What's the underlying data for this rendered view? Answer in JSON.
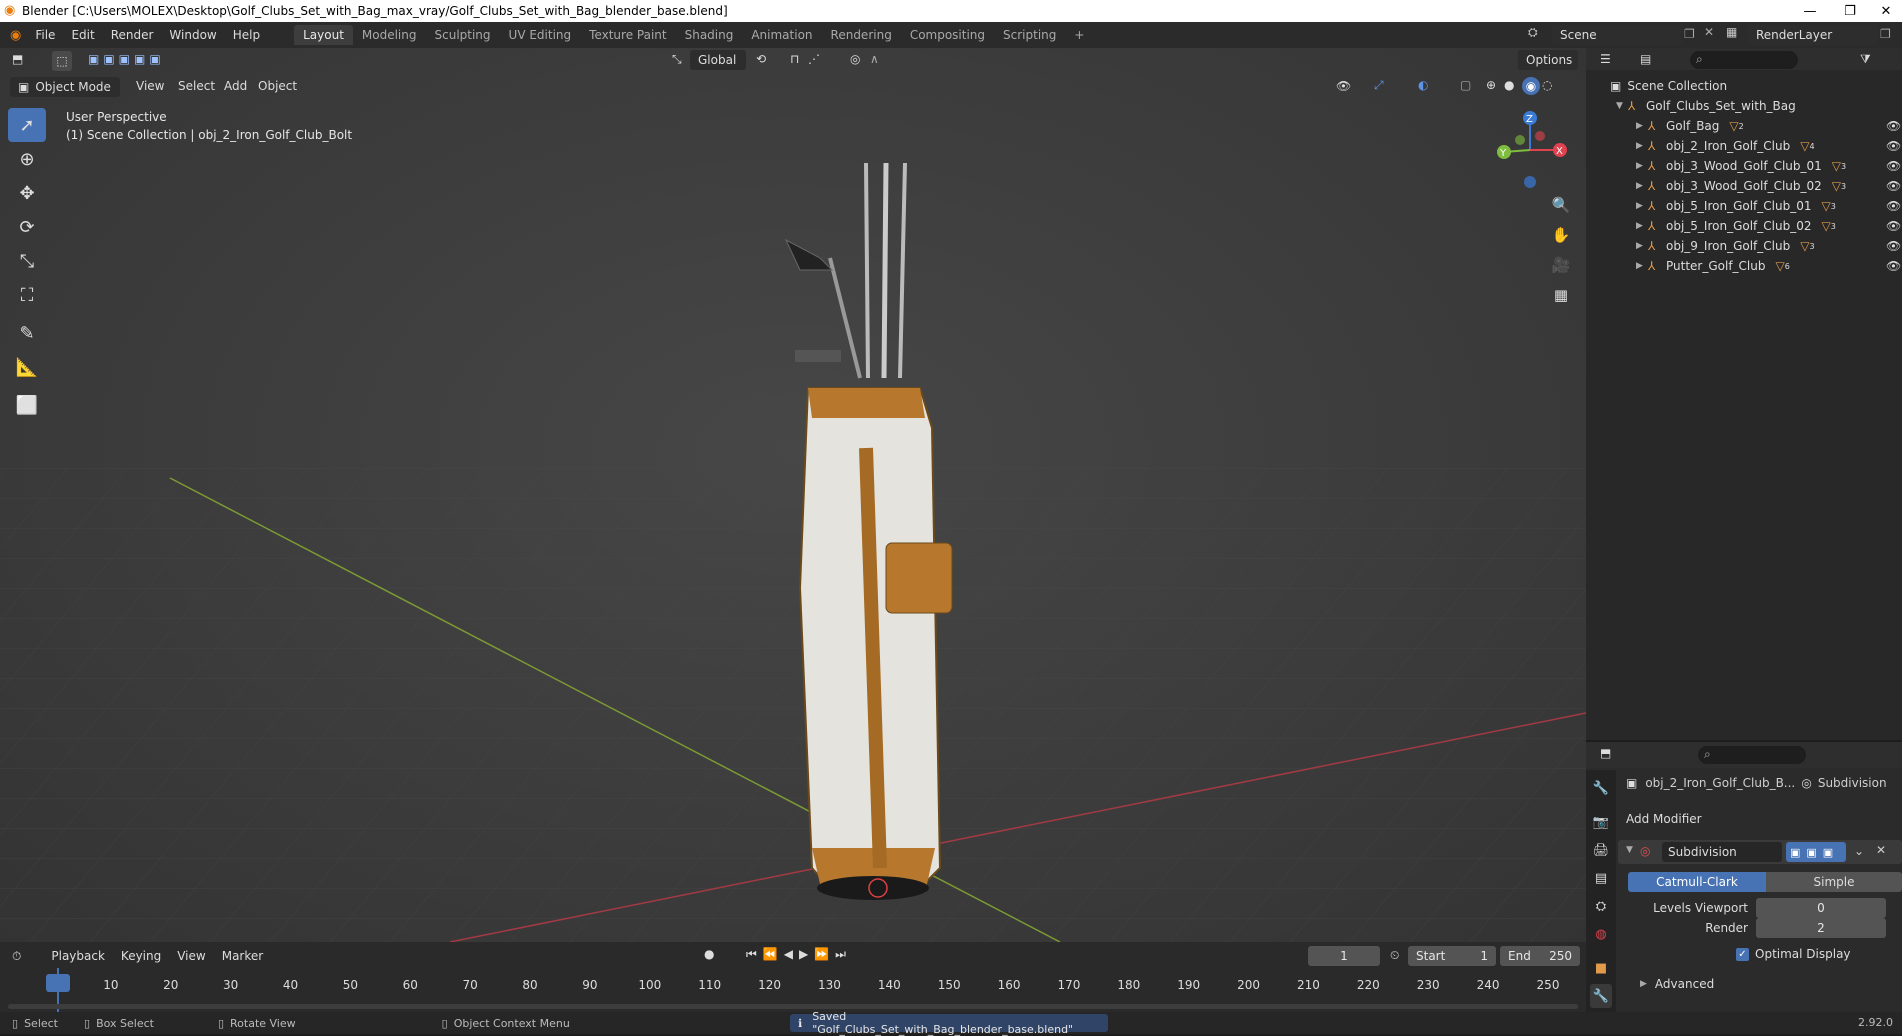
{
  "window": {
    "title": "Blender [C:\\Users\\MOLEX\\Desktop\\Golf_Clubs_Set_with_Bag_max_vray/Golf_Clubs_Set_with_Bag_blender_base.blend]",
    "minimize": "—",
    "maximize": "❐",
    "close": "✕"
  },
  "menubar": [
    "File",
    "Edit",
    "Render",
    "Window",
    "Help"
  ],
  "workspaces": [
    {
      "label": "Layout",
      "active": true
    },
    {
      "label": "Modeling"
    },
    {
      "label": "Sculpting"
    },
    {
      "label": "UV Editing"
    },
    {
      "label": "Texture Paint"
    },
    {
      "label": "Shading"
    },
    {
      "label": "Animation"
    },
    {
      "label": "Rendering"
    },
    {
      "label": "Compositing"
    },
    {
      "label": "Scripting"
    }
  ],
  "add_workspace": "+",
  "scene": {
    "label": "Scene",
    "render_layer": "RenderLayer"
  },
  "viewport_header": {
    "transform_orientation": "Global",
    "options": "Options",
    "mode": "Object Mode",
    "menus": [
      "View",
      "Select",
      "Add",
      "Object"
    ]
  },
  "viewport_overlay": {
    "perspective": "User Perspective",
    "collection_info": "(1) Scene Collection | obj_2_Iron_Golf_Club_Bolt"
  },
  "gizmo": {
    "x": "X",
    "y": "Y",
    "z": "Z"
  },
  "outliner": {
    "root": "Scene Collection",
    "collection": "Golf_Clubs_Set_with_Bag",
    "items": [
      {
        "name": "Golf_Bag",
        "count": "2"
      },
      {
        "name": "obj_2_Iron_Golf_Club",
        "count": "4"
      },
      {
        "name": "obj_3_Wood_Golf_Club_01",
        "count": "3"
      },
      {
        "name": "obj_3_Wood_Golf_Club_02",
        "count": "3"
      },
      {
        "name": "obj_5_Iron_Golf_Club_01",
        "count": "3"
      },
      {
        "name": "obj_5_Iron_Golf_Club_02",
        "count": "3"
      },
      {
        "name": "obj_9_Iron_Golf_Club",
        "count": "3"
      },
      {
        "name": "Putter_Golf_Club",
        "count": "6"
      }
    ]
  },
  "properties": {
    "object_name": "obj_2_Iron_Golf_Club_B...",
    "modifier_tab": "Subdivision",
    "add_modifier": "Add Modifier",
    "modifier": {
      "name": "Subdivision",
      "type_a": "Catmull-Clark",
      "type_b": "Simple",
      "levels_viewport_label": "Levels Viewport",
      "levels_viewport": "0",
      "render_label": "Render",
      "render": "2",
      "optimal_display": "Optimal Display",
      "advanced": "Advanced"
    }
  },
  "timeline": {
    "menus": [
      "Playback",
      "Keying",
      "View",
      "Marker"
    ],
    "current_frame": "1",
    "start_label": "Start",
    "start": "1",
    "end_label": "End",
    "end": "250",
    "ticks": [
      "1",
      "10",
      "20",
      "30",
      "40",
      "50",
      "60",
      "70",
      "80",
      "90",
      "100",
      "110",
      "120",
      "130",
      "140",
      "150",
      "160",
      "170",
      "180",
      "190",
      "200",
      "210",
      "220",
      "230",
      "240",
      "250"
    ]
  },
  "statusbar": {
    "select": "Select",
    "box_select": "Box Select",
    "rotate_view": "Rotate View",
    "context_menu": "Object Context Menu",
    "message": "Saved \"Golf_Clubs_Set_with_Bag_blender_base.blend\"",
    "version": "2.92.0"
  },
  "colors": {
    "accent": "#4772b3",
    "object_orange": "#e19a4a",
    "axis_x": "#e0424f",
    "axis_y": "#7fbd3e",
    "axis_z": "#3a7bd5"
  }
}
